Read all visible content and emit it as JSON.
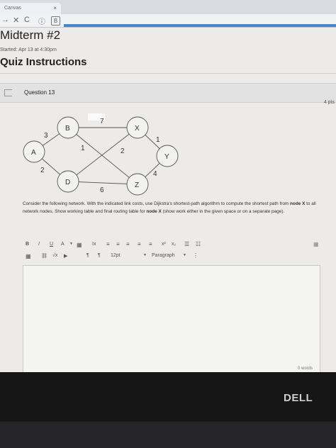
{
  "browser": {
    "tab_title": "Canvas",
    "tab_close": "×",
    "nav_back": "→",
    "nav_close": "✕",
    "nav_reload": "C",
    "nav_info": "ⓘ",
    "nav_page": "B"
  },
  "page": {
    "title": "Midterm #2",
    "started": "Started: Apr 13 at 4:30pm",
    "quiz_instructions": "Quiz Instructions"
  },
  "question": {
    "title": "Question 13",
    "points": "4 pts",
    "text_parts": [
      "Consider the following network. With the indicated link costs, use Dijkstra's shortest-path algorithm to compute the shortest path from ",
      "node X",
      " to all network nodes. Show working table and final routing table for ",
      "node X",
      " (show work either in the given space or on a separate page)."
    ]
  },
  "graph": {
    "nodes": [
      "A",
      "B",
      "D",
      "X",
      "Z",
      "Y"
    ],
    "edge_costs": [
      "3",
      "2",
      "7",
      "1",
      "2",
      "6",
      "1",
      "4"
    ]
  },
  "toolbar": {
    "bold": "B",
    "italic": "I",
    "underline": "U",
    "font_color": "A",
    "highlight": "▼",
    "clear_format": "Ix",
    "align_left": "≡",
    "align_center": "≡",
    "align_right": "≡",
    "align_justify": "≡",
    "superscript": "x²",
    "subscript": "x₂",
    "bullet_list": "☰",
    "numbered_list": "☷",
    "table": "▦",
    "link": "⛓",
    "equation": "√x",
    "media": "▶",
    "ltr": "¶",
    "rtl": "¶",
    "font_size": "12pt",
    "paragraph": "Paragraph",
    "more": "⋮"
  },
  "editor": {
    "word_count": "0 words"
  },
  "laptop": {
    "brand": "DELL"
  },
  "colors": {
    "accent_blue": "#4a86c5"
  }
}
